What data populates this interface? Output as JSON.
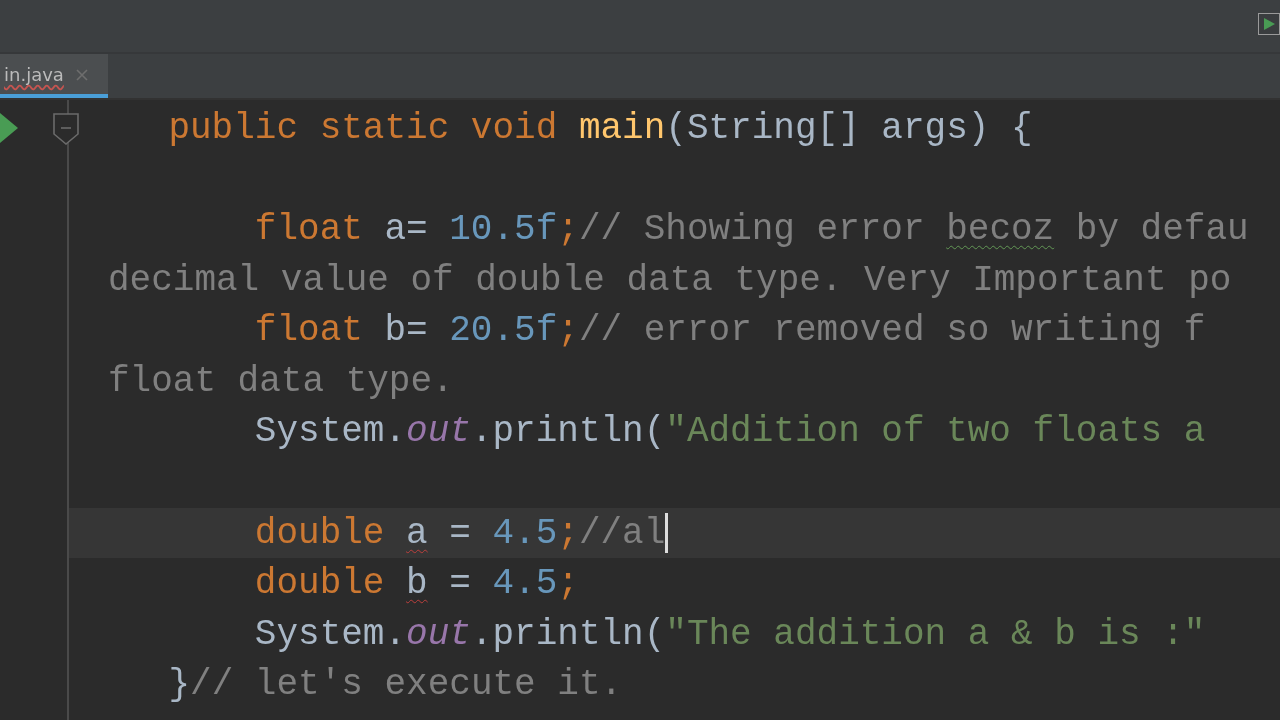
{
  "tabs": [
    {
      "label": "in.java",
      "selected": true,
      "error": true
    }
  ],
  "editor": {
    "rows": [
      {
        "kind": "code",
        "current": false,
        "tokens": [
          {
            "kind": "keyword",
            "text": "    public static void "
          },
          {
            "kind": "method",
            "text": "main"
          },
          {
            "kind": "plain",
            "text": "(String[] args) {"
          }
        ]
      },
      {
        "kind": "blank",
        "current": false
      },
      {
        "kind": "code",
        "current": false,
        "tokens": [
          {
            "kind": "keyword",
            "text": "        float "
          },
          {
            "kind": "plain",
            "text": "a= "
          },
          {
            "kind": "number",
            "text": "10.5f"
          },
          {
            "kind": "keyword",
            "text": ";"
          },
          {
            "kind": "comment",
            "text": "// Showing error "
          },
          {
            "kind": "comment",
            "text": "becoz",
            "typo": true
          },
          {
            "kind": "comment",
            "text": " by defau"
          }
        ]
      },
      {
        "kind": "wrap",
        "current": false,
        "tokens": [
          {
            "kind": "comment",
            "text": "decimal value of double data type. Very Important po"
          }
        ]
      },
      {
        "kind": "code",
        "current": false,
        "tokens": [
          {
            "kind": "keyword",
            "text": "        float "
          },
          {
            "kind": "plain",
            "text": "b= "
          },
          {
            "kind": "number",
            "text": "20.5f"
          },
          {
            "kind": "keyword",
            "text": ";"
          },
          {
            "kind": "comment",
            "text": "// error removed so writing f"
          }
        ]
      },
      {
        "kind": "wrap",
        "current": false,
        "tokens": [
          {
            "kind": "comment",
            "text": "float data type."
          }
        ]
      },
      {
        "kind": "code",
        "current": false,
        "tokens": [
          {
            "kind": "plain",
            "text": "        System."
          },
          {
            "kind": "field",
            "text": "out"
          },
          {
            "kind": "plain",
            "text": ".println("
          },
          {
            "kind": "string",
            "text": "\"Addition of two floats a"
          }
        ]
      },
      {
        "kind": "blank",
        "current": false
      },
      {
        "kind": "code",
        "current": true,
        "tokens": [
          {
            "kind": "keyword",
            "text": "        double "
          },
          {
            "kind": "plain",
            "text": "a",
            "error": true
          },
          {
            "kind": "plain",
            "text": " = "
          },
          {
            "kind": "number",
            "text": "4.5"
          },
          {
            "kind": "keyword",
            "text": ";"
          },
          {
            "kind": "comment",
            "text": "//al"
          }
        ]
      },
      {
        "kind": "code",
        "current": false,
        "tokens": [
          {
            "kind": "keyword",
            "text": "        double "
          },
          {
            "kind": "plain",
            "text": "b",
            "error": true
          },
          {
            "kind": "plain",
            "text": " = "
          },
          {
            "kind": "number",
            "text": "4.5"
          },
          {
            "kind": "keyword",
            "text": ";"
          }
        ]
      },
      {
        "kind": "code",
        "current": false,
        "tokens": [
          {
            "kind": "plain",
            "text": "        System."
          },
          {
            "kind": "field",
            "text": "out"
          },
          {
            "kind": "plain",
            "text": ".println("
          },
          {
            "kind": "string",
            "text": "\"The addition a & b is :\""
          }
        ]
      },
      {
        "kind": "code",
        "current": false,
        "tokens": [
          {
            "kind": "plain",
            "text": "    }"
          },
          {
            "kind": "comment",
            "text": "// let's execute it."
          }
        ]
      }
    ]
  }
}
